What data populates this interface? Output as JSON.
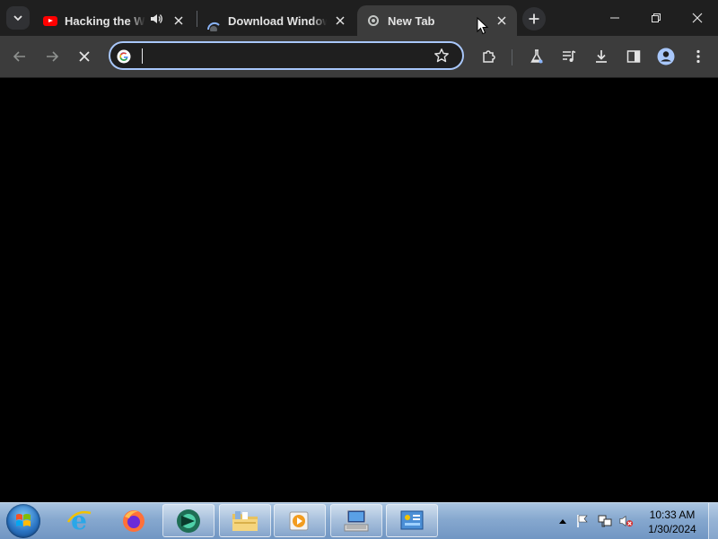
{
  "browser": {
    "tabs": [
      {
        "title": "Hacking the Windows",
        "favicon": "youtube-icon",
        "audio": true
      },
      {
        "title": "Download Windows",
        "favicon": "loading-spinner-icon"
      },
      {
        "title": "New Tab",
        "favicon": "loading-icon",
        "active": true
      }
    ],
    "omnibox": {
      "value": "",
      "search_engine_icon": "google-icon"
    }
  },
  "taskbar": {
    "apps": [
      {
        "name": "Internet Explorer",
        "icon": "ie-icon"
      },
      {
        "name": "Firefox",
        "icon": "firefox-icon"
      },
      {
        "name": "Chrome Canary-like browser",
        "icon": "browser-icon",
        "pinned_active": true
      },
      {
        "name": "Windows Explorer",
        "icon": "folder-icon",
        "pinned_active": true
      },
      {
        "name": "Media Player",
        "icon": "media-player-icon",
        "pinned_active": true
      },
      {
        "name": "Remote Desktop",
        "icon": "remote-desktop-icon",
        "pinned_active": true
      },
      {
        "name": "Control Panel",
        "icon": "control-panel-icon",
        "pinned_active": true
      }
    ],
    "clock": {
      "time": "10:33 AM",
      "date": "1/30/2024"
    }
  },
  "colors": {
    "tabstrip_bg": "#1f1f1f",
    "toolbar_bg": "#3c3c3c",
    "omnibox_border": "#a8c7fa",
    "youtube_red": "#ff0000"
  }
}
